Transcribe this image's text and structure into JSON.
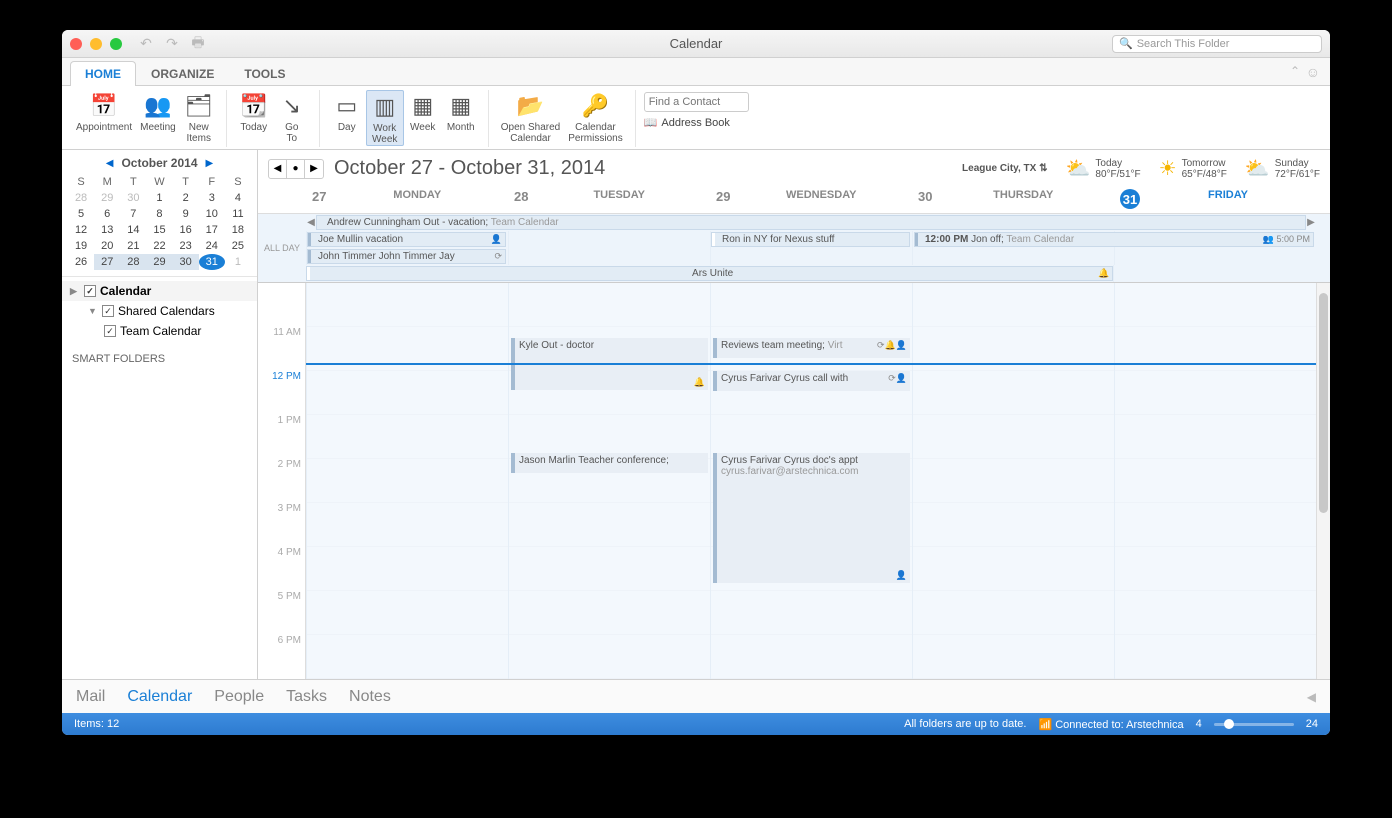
{
  "window": {
    "title": "Calendar",
    "search_placeholder": "Search This Folder"
  },
  "tabs": {
    "home": "HOME",
    "organize": "ORGANIZE",
    "tools": "TOOLS"
  },
  "ribbon": {
    "appointment": "Appointment",
    "meeting": "Meeting",
    "new_items": "New\nItems",
    "today": "Today",
    "goto": "Go\nTo",
    "day": "Day",
    "workweek": "Work\nWeek",
    "week": "Week",
    "month": "Month",
    "open_shared": "Open Shared\nCalendar",
    "permissions": "Calendar\nPermissions",
    "find_contact": "Find a Contact",
    "address_book": "Address Book"
  },
  "minical": {
    "title": "October 2014",
    "dow": [
      "S",
      "M",
      "T",
      "W",
      "T",
      "F",
      "S"
    ],
    "rows": [
      [
        "28",
        "29",
        "30",
        "1",
        "2",
        "3",
        "4"
      ],
      [
        "5",
        "6",
        "7",
        "8",
        "9",
        "10",
        "11"
      ],
      [
        "12",
        "13",
        "14",
        "15",
        "16",
        "17",
        "18"
      ],
      [
        "19",
        "20",
        "21",
        "22",
        "23",
        "24",
        "25"
      ],
      [
        "26",
        "27",
        "28",
        "29",
        "30",
        "31",
        "1"
      ]
    ]
  },
  "sidebar": {
    "calendar": "Calendar",
    "shared": "Shared Calendars",
    "team": "Team Calendar",
    "smart": "SMART FOLDERS"
  },
  "range": "October 27 - October 31, 2014",
  "location": "League City, TX",
  "weather": [
    {
      "label": "Today",
      "temp": "80°F/51°F"
    },
    {
      "label": "Tomorrow",
      "temp": "65°F/48°F"
    },
    {
      "label": "Sunday",
      "temp": "72°F/61°F"
    }
  ],
  "days": [
    {
      "num": "27",
      "name": "MONDAY"
    },
    {
      "num": "28",
      "name": "TUESDAY"
    },
    {
      "num": "29",
      "name": "WEDNESDAY"
    },
    {
      "num": "30",
      "name": "THURSDAY"
    },
    {
      "num": "31",
      "name": "FRIDAY"
    }
  ],
  "allday": {
    "label": "ALL DAY",
    "row1": {
      "text": "Andrew Cunningham Out - vacation; ",
      "mut": "Team Calendar"
    },
    "row2": {
      "a": "Joe Mullin vacation",
      "b": "Ron in NY for Nexus stuff",
      "c_time": "12:00 PM",
      "c_text": "Jon off; ",
      "c_mut": "Team Calendar",
      "c_right": "5:00 PM"
    },
    "row3": {
      "a": "John Timmer John Timmer Jay"
    },
    "row4": {
      "a": "Ars Unite"
    }
  },
  "hours": [
    "",
    "11 AM",
    "12 PM",
    "1 PM",
    "2 PM",
    "3 PM",
    "4 PM",
    "5 PM",
    "6 PM"
  ],
  "events": {
    "kyle": "Kyle Out - doctor",
    "reviews": "Reviews team meeting; ",
    "reviews_mut": "Virt",
    "call": "Cyrus Farivar Cyrus call with",
    "jason": "Jason Marlin Teacher conference;",
    "doc": "Cyrus Farivar Cyrus doc's appt",
    "doc_sub": "cyrus.farivar@arstechnica.com"
  },
  "switcher": {
    "mail": "Mail",
    "calendar": "Calendar",
    "people": "People",
    "tasks": "Tasks",
    "notes": "Notes"
  },
  "status": {
    "items": "Items: 12",
    "sync": "All folders are up to date.",
    "conn": "Connected to: Arstechnica",
    "zmin": "4",
    "zmax": "24"
  }
}
